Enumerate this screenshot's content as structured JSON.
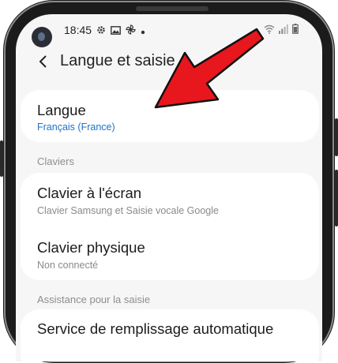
{
  "status_bar": {
    "time": "18:45"
  },
  "header": {
    "title": "Langue et saisie"
  },
  "language_card": {
    "title": "Langue",
    "value": "Français (France)"
  },
  "sections": {
    "keyboards": "Claviers",
    "assist": "Assistance pour la saisie"
  },
  "keyboard_items": [
    {
      "title": "Clavier à l'écran",
      "subtitle": "Clavier Samsung et Saisie vocale Google"
    },
    {
      "title": "Clavier physique",
      "subtitle": "Non connecté"
    }
  ],
  "assist_items": [
    {
      "title": "Service de remplissage automatique"
    }
  ],
  "colors": {
    "accent": "#1d72c9",
    "annotation_arrow": "#e8171d",
    "background": "#f6f6f6"
  }
}
